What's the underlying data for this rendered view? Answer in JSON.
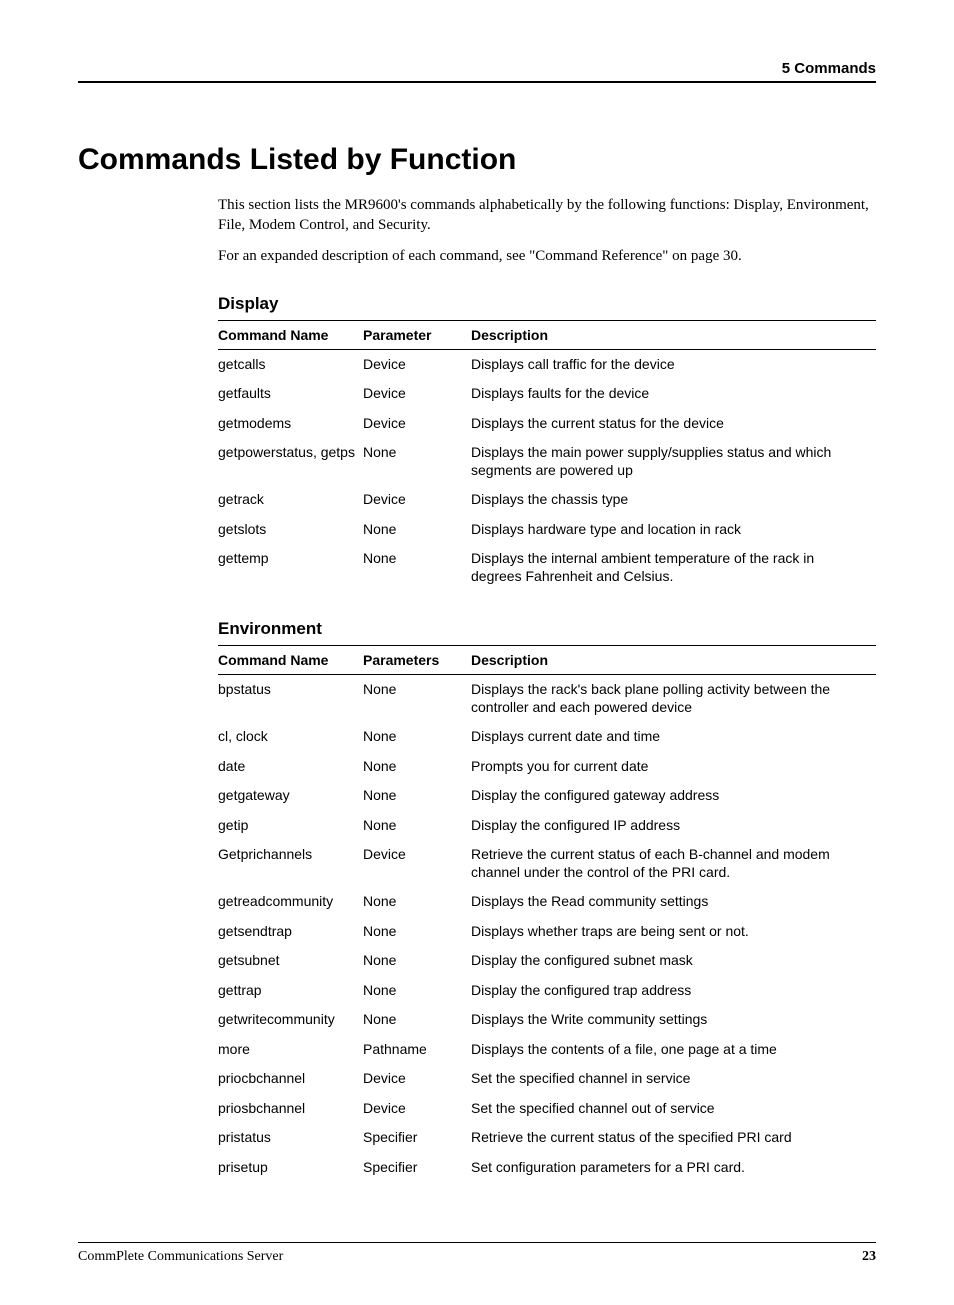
{
  "header": {
    "chapter": "5   Commands"
  },
  "title": "Commands Listed by Function",
  "intro": {
    "p1": "This section lists the MR9600's commands alphabetically by the following functions: Display, Environment, File, Modem Control, and Security.",
    "p2": "For an expanded description of each command, see \"Command Reference\" on page 30."
  },
  "sections": {
    "display": {
      "heading": "Display",
      "col1": "Command Name",
      "col2": "Parameter",
      "col3": "Description",
      "rows": [
        {
          "name": "getcalls",
          "param": "Device",
          "desc": "Displays call traffic for the device"
        },
        {
          "name": "getfaults",
          "param": "Device",
          "desc": "Displays faults for the device"
        },
        {
          "name": "getmodems",
          "param": "Device",
          "desc": "Displays the current status for the device"
        },
        {
          "name": "getpowerstatus, getps",
          "param": "None",
          "desc": "Displays the main power supply/supplies status and which segments are powered up"
        },
        {
          "name": "getrack",
          "param": "Device",
          "desc": "Displays the chassis type"
        },
        {
          "name": "getslots",
          "param": "None",
          "desc": "Displays hardware type and location in rack"
        },
        {
          "name": "gettemp",
          "param": "None",
          "desc": "Displays the internal ambient temperature of the rack in degrees Fahrenheit and Celsius."
        }
      ]
    },
    "environment": {
      "heading": "Environment",
      "col1": "Command Name",
      "col2": "Parameters",
      "col3": "Description",
      "rows": [
        {
          "name": "bpstatus",
          "param": "None",
          "desc": "Displays the rack's back plane polling activity between the controller and each powered device"
        },
        {
          "name": "cl, clock",
          "param": "None",
          "desc": "Displays current date and time"
        },
        {
          "name": "date",
          "param": "None",
          "desc": "Prompts you for current date"
        },
        {
          "name": "getgateway",
          "param": "None",
          "desc": "Display the configured gateway address"
        },
        {
          "name": "getip",
          "param": "None",
          "desc": "Display the configured IP address"
        },
        {
          "name": "Getprichannels",
          "param": "Device",
          "desc": "Retrieve the current status of each B-channel and modem channel under the control of the PRI card."
        },
        {
          "name": "getreadcommunity",
          "param": "None",
          "desc": "Displays the Read community settings"
        },
        {
          "name": "getsendtrap",
          "param": "None",
          "desc": "Displays whether traps are being sent or not."
        },
        {
          "name": "getsubnet",
          "param": "None",
          "desc": "Display the configured subnet mask"
        },
        {
          "name": "gettrap",
          "param": "None",
          "desc": "Display the configured trap address"
        },
        {
          "name": "getwritecommunity",
          "param": "None",
          "desc": "Displays the Write community settings"
        },
        {
          "name": "more",
          "param": "Pathname",
          "desc": "Displays the contents of a file, one page at a time"
        },
        {
          "name": "priocbchannel",
          "param": "Device",
          "desc": "Set the specified channel in service"
        },
        {
          "name": "priosbchannel",
          "param": "Device",
          "desc": "Set the specified channel out of service"
        },
        {
          "name": "pristatus",
          "param": "Specifier",
          "desc": "Retrieve the current status of the specified PRI card"
        },
        {
          "name": "prisetup",
          "param": "Specifier",
          "desc": "Set configuration parameters for a PRI card."
        }
      ]
    }
  },
  "footer": {
    "left": "CommPlete Communications Server",
    "right": "23"
  }
}
